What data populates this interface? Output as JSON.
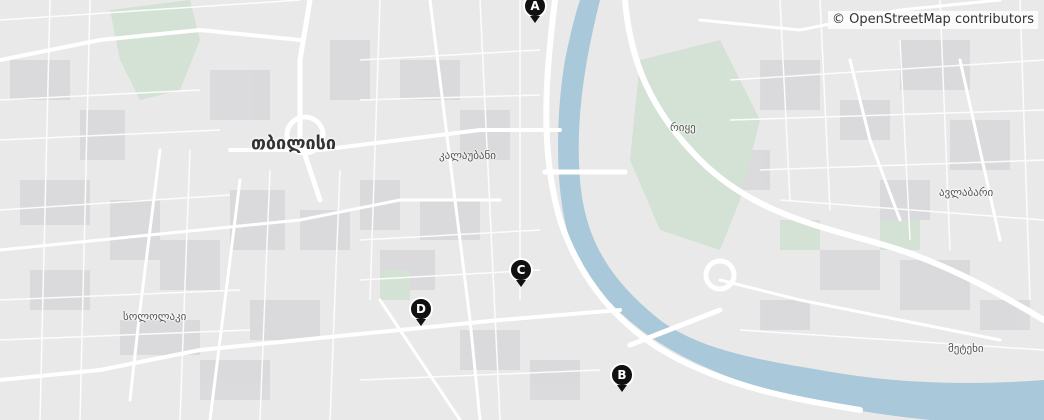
{
  "attribution": "© OpenStreetMap contributors",
  "labels": {
    "city": "თბილისი",
    "kalaubani": "კალაუბანი",
    "rike": "რიყე",
    "avlabari": "ავლაბარი",
    "sololaki": "სოლოლაკი",
    "metekhi": "მეტეხი"
  },
  "markers": [
    {
      "id": "A",
      "label": "A"
    },
    {
      "id": "B",
      "label": "B"
    },
    {
      "id": "C",
      "label": "C"
    },
    {
      "id": "D",
      "label": "D"
    }
  ],
  "colors": {
    "land": "#e9e9ea",
    "block": "#d9d9db",
    "road": "#ffffff",
    "river": "#a9c8d9",
    "park": "#d3e2d5"
  }
}
